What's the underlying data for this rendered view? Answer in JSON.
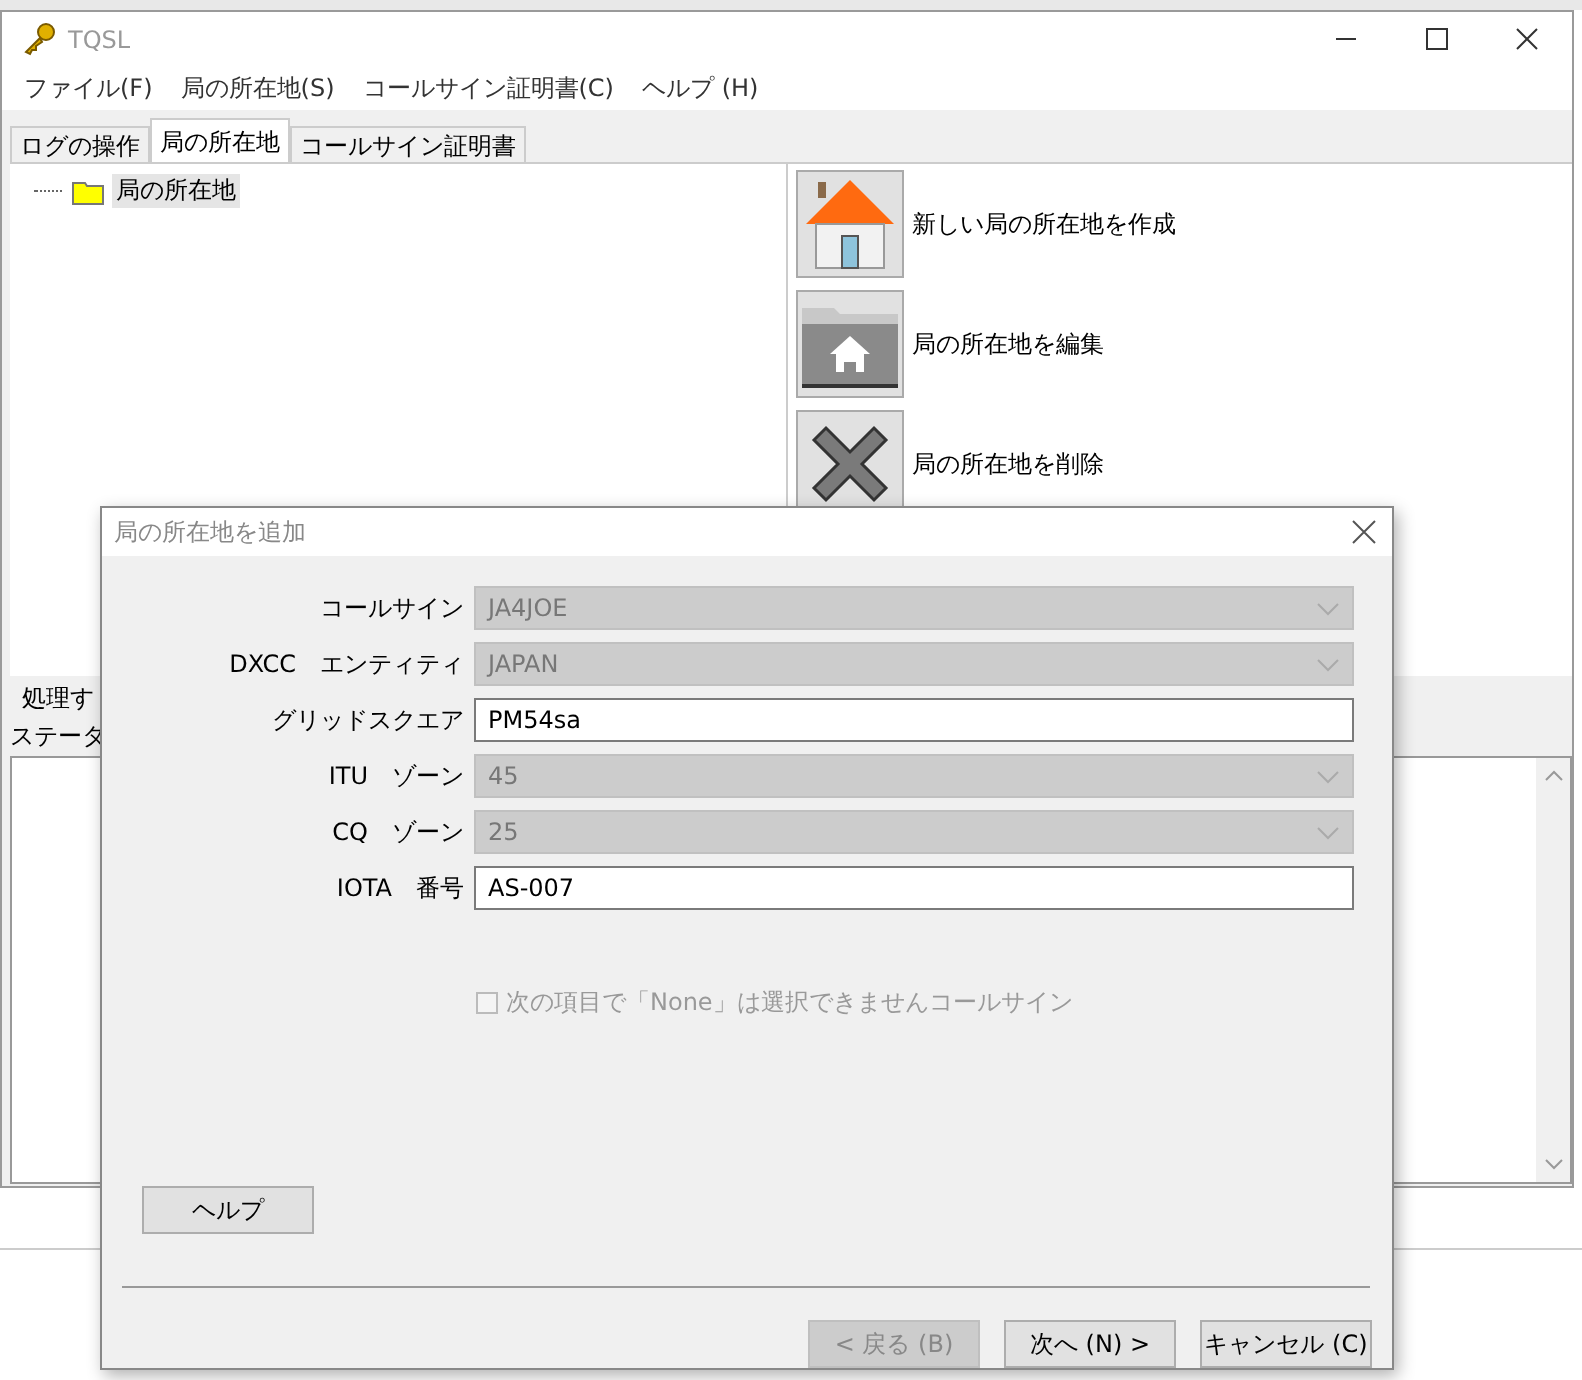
{
  "window": {
    "title": "TQSL"
  },
  "menu": [
    {
      "label": "ファイル(F)"
    },
    {
      "label": "局の所在地(S)"
    },
    {
      "label": "コールサイン証明書(C)"
    },
    {
      "label": "ヘルプ (H)"
    }
  ],
  "tabs": [
    {
      "label": "ログの操作",
      "selected": false
    },
    {
      "label": "局の所在地",
      "selected": true
    },
    {
      "label": "コールサイン証明書",
      "selected": false
    }
  ],
  "tree": {
    "items": [
      {
        "label": "局の所在地",
        "selected": true
      }
    ]
  },
  "actions": [
    {
      "kind": "new",
      "label": "新しい局の所在地を作成"
    },
    {
      "kind": "edit",
      "label": "局の所在地を編集"
    },
    {
      "kind": "delete",
      "label": "局の所在地を削除"
    }
  ],
  "process_label": "処理す",
  "status_label": "ステータ",
  "dialog": {
    "title": "局の所在地を追加",
    "fields": [
      {
        "label": "コールサイン",
        "value": "JA4JOE",
        "kind": "combo",
        "disabled": true
      },
      {
        "label": "DXCC　エンティティ",
        "value": "JAPAN",
        "kind": "combo",
        "disabled": true
      },
      {
        "label": "グリッドスクエア",
        "value": "PM54sa",
        "kind": "text",
        "disabled": false
      },
      {
        "label": "ITU　ゾーン",
        "value": "45",
        "kind": "combo",
        "disabled": true
      },
      {
        "label": "CQ　ゾーン",
        "value": "25",
        "kind": "combo",
        "disabled": true
      },
      {
        "label": "IOTA　番号",
        "value": "AS-007",
        "kind": "text",
        "disabled": false
      }
    ],
    "checkbox": {
      "label": "次の項目で「None」は選択できませんコールサイン",
      "checked": false,
      "disabled": true
    },
    "help_button": "ヘルプ",
    "buttons": [
      {
        "label": "< 戻る (B)",
        "disabled": true
      },
      {
        "label": "次へ (N) >",
        "disabled": false
      },
      {
        "label": "キャンセル (C)",
        "disabled": false
      }
    ]
  }
}
